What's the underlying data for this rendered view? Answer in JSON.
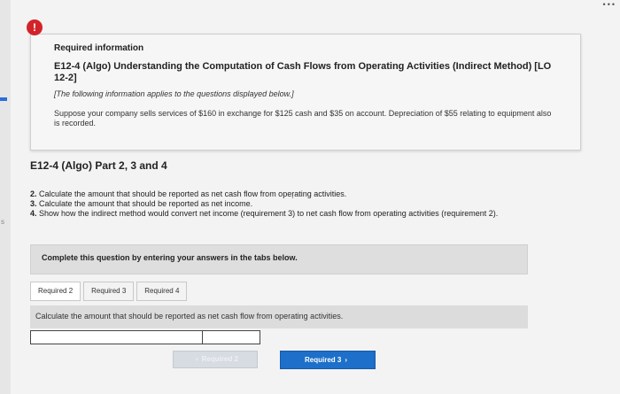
{
  "alert_icon": "!",
  "info": {
    "title": "Required information",
    "heading": "E12-4 (Algo) Understanding the Computation of Cash Flows from Operating Activities (Indirect Method) [LO 12-2]",
    "note": "[The following information applies to the questions displayed below.]",
    "body": "Suppose your company sells services of $160 in exchange for $125 cash and $35 on account. Depreciation of $55 relating to equipment also is recorded."
  },
  "part_title": "E12-4 (Algo) Part 2, 3 and 4",
  "requirements": [
    {
      "num": "2.",
      "text": "Calculate the amount that should be reported as net cash flow from opeŗating activities."
    },
    {
      "num": "3.",
      "text": "Calculate the amount that should be reported as net income."
    },
    {
      "num": "4.",
      "text": "Show how the indirect method would convert net income (requirement 3) to net cash flow from operating activities (requirement 2)."
    }
  ],
  "complete_prompt": "Complete this question by entering your answers in the tabs below.",
  "tabs": [
    {
      "label": "Required 2"
    },
    {
      "label": "Required 3"
    },
    {
      "label": "Required 4"
    }
  ],
  "instruction": "Calculate the amount that should be reported as net cash flow from operating activities.",
  "answer": {
    "label_value": "",
    "amount_value": ""
  },
  "nav": {
    "prev_label": "Required 2",
    "next_label": "Required 3",
    "prev_icon": "chevron-left-icon",
    "next_icon": "chevron-right-icon"
  },
  "edge": {
    "left_char": "s"
  }
}
